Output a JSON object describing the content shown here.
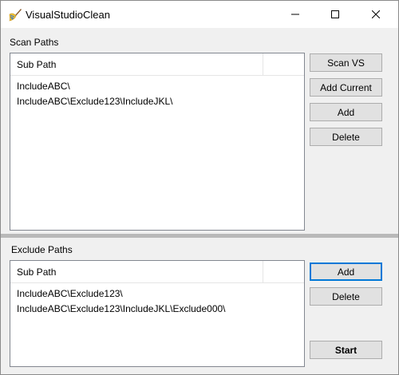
{
  "window": {
    "title": "VisualStudioClean",
    "app_icon": "broom-icon",
    "controls": [
      "minimize-icon",
      "maximize-icon",
      "close-icon"
    ]
  },
  "scan_paths": {
    "label": "Scan Paths",
    "column_header": "Sub Path",
    "rows": [
      "IncludeABC\\",
      "IncludeABC\\Exclude123\\IncludeJKL\\"
    ],
    "buttons": {
      "scan_vs": "Scan VS",
      "add_current": "Add Current",
      "add": "Add",
      "delete": "Delete"
    }
  },
  "exclude_paths": {
    "label": "Exclude Paths",
    "column_header": "Sub Path",
    "rows": [
      "IncludeABC\\Exclude123\\",
      "IncludeABC\\Exclude123\\IncludeJKL\\Exclude000\\"
    ],
    "buttons": {
      "add": "Add",
      "delete": "Delete",
      "start": "Start"
    }
  },
  "colors": {
    "window_bg": "#f0f0f0",
    "titlebar_bg": "#ffffff",
    "focus_border": "#0078d7",
    "button_bg": "#e1e1e1",
    "splitter": "#b9b9b9"
  }
}
